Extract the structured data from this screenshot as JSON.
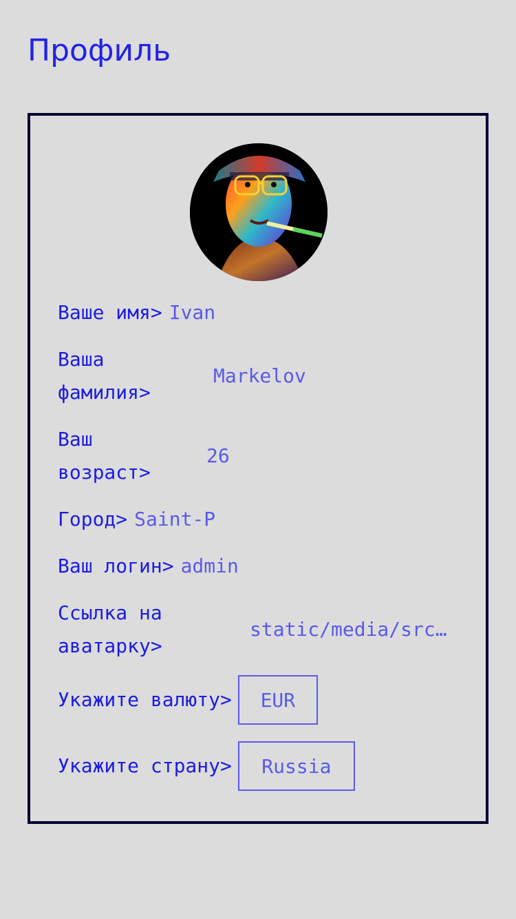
{
  "page": {
    "title": "Профиль"
  },
  "profile": {
    "avatar_icon": "user-avatar",
    "fields": {
      "name": {
        "label": "Ваше имя>",
        "value": "Ivan"
      },
      "surname": {
        "label": "Ваша\nфамилия>",
        "value": "Markelov"
      },
      "age": {
        "label": "Ваш\nвозраст>",
        "value": "26"
      },
      "city": {
        "label": "Город>",
        "value": "Saint-P"
      },
      "login": {
        "label": "Ваш логин>",
        "value": "admin"
      },
      "avatar_link": {
        "label": "Ссылка на\nаватарку>",
        "value": "static/media/src…"
      },
      "currency": {
        "label": "Укажите валюту>",
        "value": "EUR"
      },
      "country": {
        "label": "Укажите страну>",
        "value": "Russia"
      }
    }
  },
  "colors": {
    "background": "#dcdcdc",
    "title": "#2222e6",
    "label": "#1c1ce0",
    "value": "#5a5ae8",
    "card_border": "#000033"
  }
}
